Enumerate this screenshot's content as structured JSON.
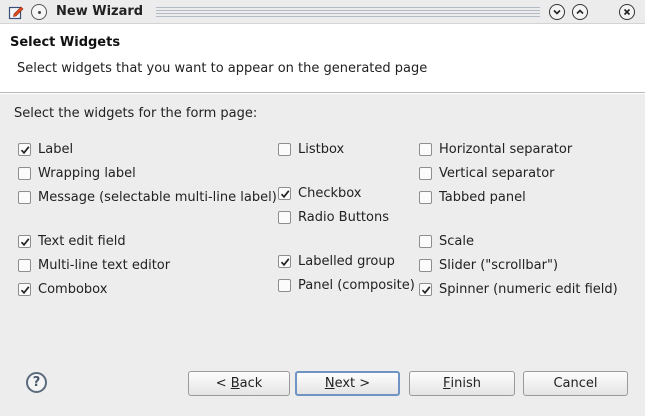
{
  "window": {
    "title": "New Wizard"
  },
  "header": {
    "title": "Select Widgets",
    "description": "Select widgets that you want to appear on the generated page"
  },
  "main": {
    "section_label": "Select the widgets for the form page:",
    "widgets": [
      {
        "label": "Label",
        "checked": true
      },
      {
        "label": "Wrapping label",
        "checked": false
      },
      {
        "label": "Message (selectable multi-line label)",
        "checked": false
      },
      {
        "label": "Text edit field",
        "checked": true
      },
      {
        "label": "Multi-line text editor",
        "checked": false
      },
      {
        "label": "Combobox",
        "checked": true
      },
      {
        "label": "Listbox",
        "checked": false
      },
      {
        "label": "Checkbox",
        "checked": true
      },
      {
        "label": "Radio Buttons",
        "checked": false
      },
      {
        "label": "Labelled group",
        "checked": true
      },
      {
        "label": "Panel (composite)",
        "checked": false
      },
      {
        "label": "Horizontal separator",
        "checked": false
      },
      {
        "label": "Vertical separator",
        "checked": false
      },
      {
        "label": "Tabbed panel",
        "checked": false
      },
      {
        "label": "Scale",
        "checked": false
      },
      {
        "label": "Slider (\"scrollbar\")",
        "checked": false
      },
      {
        "label": "Spinner (numeric edit field)",
        "checked": true
      }
    ]
  },
  "buttons": {
    "help": "?",
    "back_mnemonic": "B",
    "back_prefix": "< ",
    "back_rest": "ack",
    "next_mnemonic": "N",
    "next_rest": "ext >",
    "finish_mnemonic": "F",
    "finish_rest": "inish",
    "cancel": "Cancel"
  },
  "icons": {
    "app": "wizard-edit-icon",
    "menu": "window-menu-icon",
    "minimize": "chevron-down-icon",
    "maximize": "chevron-up-icon",
    "close": "close-icon",
    "help": "help-icon",
    "check": "check-icon"
  }
}
